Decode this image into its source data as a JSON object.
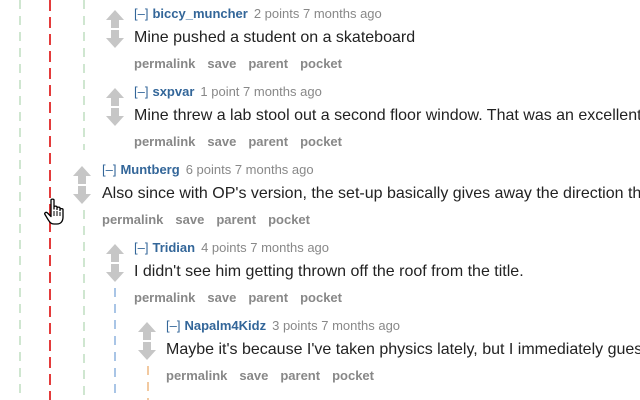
{
  "colors": {
    "link": "#336699",
    "meta": "#888888",
    "text": "#222222",
    "arrow": "#c6c6c6",
    "guide_red": "#e33b3b",
    "guide_green": "#cfe6d0",
    "guide_blue": "#a9c5e6",
    "guide_orange": "#f2c9a0"
  },
  "icons": {
    "upvote": "upvote-arrow-icon",
    "downvote": "downvote-arrow-icon",
    "cursor": "hand-pointer-cursor-icon"
  },
  "comments": [
    {
      "expand": "[–]",
      "author": "biccy_muncher",
      "meta": "2 points 7 months ago",
      "body": "Mine pushed a student on a skateboard",
      "buttons": [
        "permalink",
        "save",
        "parent",
        "pocket"
      ]
    },
    {
      "expand": "[–]",
      "author": "sxpvar",
      "meta": "1 point 7 months ago",
      "body": "Mine threw a lab stool out a second floor window. That was an excellent",
      "buttons": [
        "permalink",
        "save",
        "parent",
        "pocket"
      ]
    },
    {
      "expand": "[–]",
      "author": "Muntberg",
      "meta": "6 points 7 months ago",
      "body": "Also since with OP's version, the set-up basically gives away the direction th",
      "buttons": [
        "permalink",
        "save",
        "parent",
        "pocket"
      ]
    },
    {
      "expand": "[–]",
      "author": "Tridian",
      "meta": "4 points 7 months ago",
      "body": "I didn't see him getting thrown off the roof from the title.",
      "buttons": [
        "permalink",
        "save",
        "parent",
        "pocket"
      ]
    },
    {
      "expand": "[–]",
      "author": "Napalm4Kidz",
      "meta": "3 points 7 months ago",
      "body": "Maybe it's because I've taken physics lately, but I immediately gues",
      "buttons": [
        "permalink",
        "save",
        "parent",
        "pocket"
      ]
    }
  ]
}
